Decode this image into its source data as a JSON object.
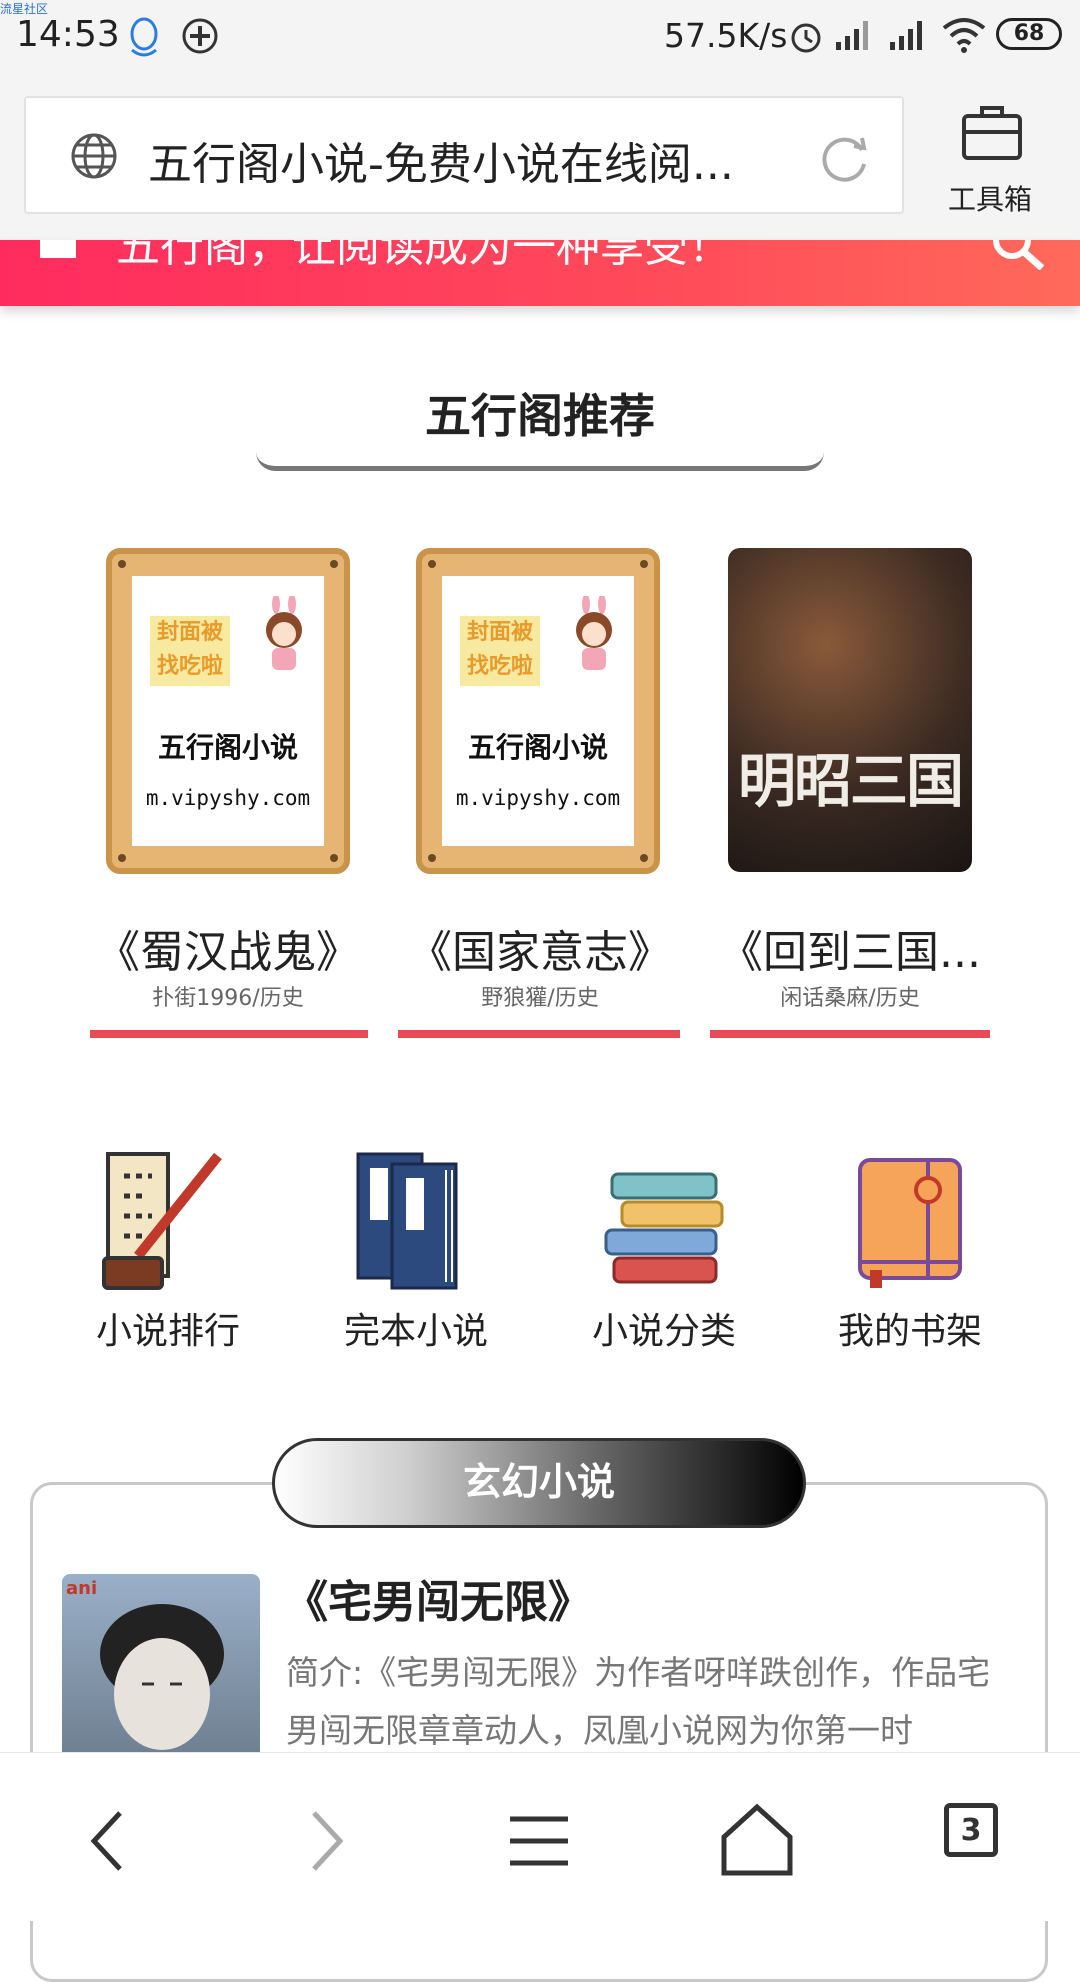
{
  "status_bar": {
    "watermark": "流星社区",
    "time": "14:53",
    "net_speed": "57.5K/s",
    "battery": "68"
  },
  "address_bar": {
    "url_title": "五行阁小说-免费小说在线阅...",
    "toolbox_label": "工具箱"
  },
  "banner": {
    "slogan": "五行阁，让阅读成为一种享受！"
  },
  "recommend": {
    "title": "五行阁推荐",
    "books": [
      {
        "title": "《蜀汉战鬼》",
        "meta": "扑街1996/历史",
        "cover_chip": "封面被找吃啦",
        "cover_site": "五行阁小说",
        "cover_domain": "m.vipyshy.com"
      },
      {
        "title": "《国家意志》",
        "meta": "野狼獾/历史",
        "cover_chip": "封面被找吃啦",
        "cover_site": "五行阁小说",
        "cover_domain": "m.vipyshy.com"
      },
      {
        "title": "《回到三国...",
        "meta": "闲话桑麻/历史",
        "cover_title": "明昭三国"
      }
    ]
  },
  "categories": [
    {
      "label": "小说排行",
      "icon": "scroll-brush-icon"
    },
    {
      "label": "完本小说",
      "icon": "books-blue-icon"
    },
    {
      "label": "小说分类",
      "icon": "book-stack-icon"
    },
    {
      "label": "我的书架",
      "icon": "notebook-icon"
    }
  ],
  "genre": {
    "pill": "玄幻小说",
    "novel_title": "《宅男闯无限》",
    "novel_intro": "简介:《宅男闯无限》为作者呀咩跌创作，作品宅男闯无限章章动人，凤凰小说网为你第一时",
    "cover_logo": "ani"
  },
  "bottom_nav": {
    "tab_count": "3"
  },
  "colors": {
    "accent": "#e84b56",
    "banner": "#ff3a5c"
  }
}
